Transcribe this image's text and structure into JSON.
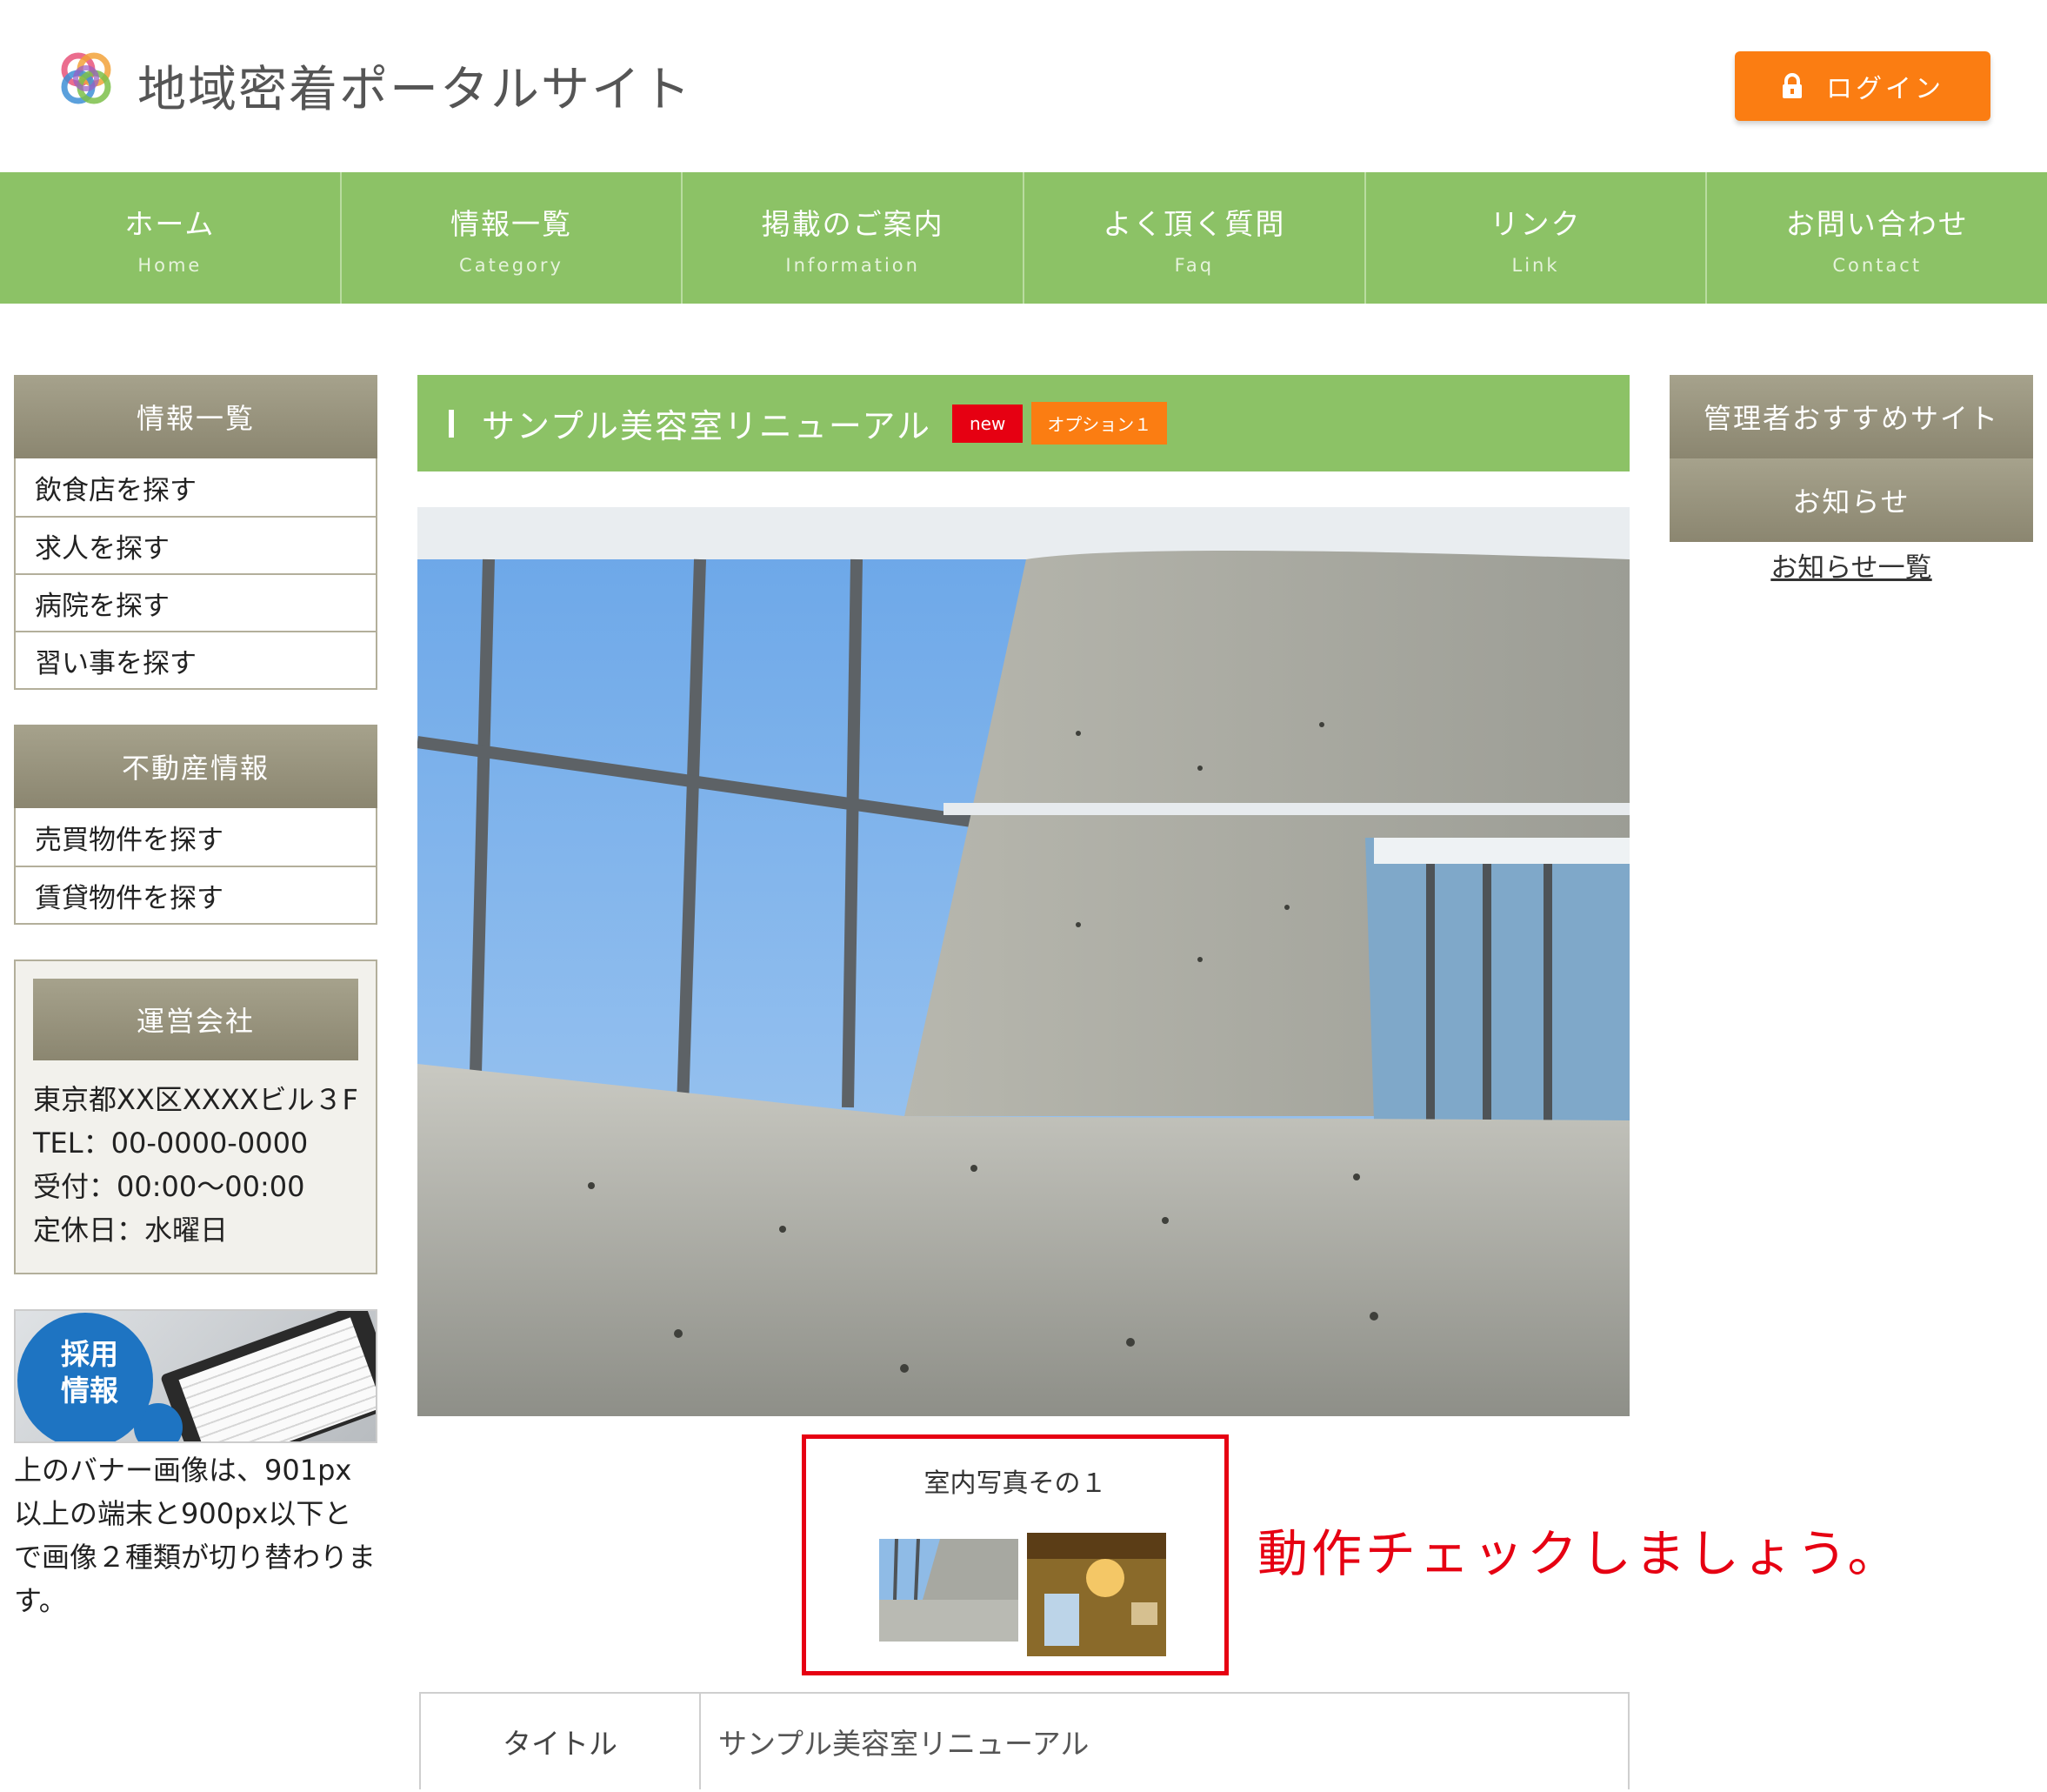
{
  "header": {
    "site_title": "地域密着ポータルサイト",
    "login_label": "ログイン",
    "logo_icon": "interlocking-rings-logo",
    "lock_icon": "lock-icon",
    "login_color": "#fb7d12"
  },
  "nav": {
    "items": [
      {
        "jp": "ホーム",
        "en": "Home"
      },
      {
        "jp": "情報一覧",
        "en": "Category"
      },
      {
        "jp": "掲載のご案内",
        "en": "Information"
      },
      {
        "jp": "よく頂く質問",
        "en": "Faq"
      },
      {
        "jp": "リンク",
        "en": "Link"
      },
      {
        "jp": "お問い合わせ",
        "en": "Contact"
      }
    ],
    "color": "#8cc266"
  },
  "sidebar_left": {
    "info_heading": "情報一覧",
    "info_items": [
      "飲食店を探す",
      "求人を探す",
      "病院を探す",
      "習い事を探す"
    ],
    "realestate_heading": "不動産情報",
    "realestate_items": [
      "売買物件を探す",
      "賃貸物件を探す"
    ],
    "company_heading": "運営会社",
    "company_address": "東京都XX区XXXXビル３F",
    "company_tel": "TEL：00-0000-0000",
    "company_hours": "受付：00:00〜00:00",
    "company_holiday": "定休日：水曜日",
    "banner_text_line1": "採用",
    "banner_text_line2": "情報",
    "banner_note": "上のバナー画像は、901px以上の端末と900px以下とで画像２種類が切り替わります。"
  },
  "main": {
    "title": "サンプル美容室リニューアル",
    "badge_new": "new",
    "badge_option": "オプション１",
    "photo_caption": "室内写真その１",
    "annotation": "動作チェックしましょう。",
    "detail_rows": [
      {
        "label": "タイトル",
        "value": "サンプル美容室リニューアル"
      }
    ]
  },
  "sidebar_right": {
    "recommend_heading": "管理者おすすめサイト",
    "news_heading": "お知らせ",
    "news_link": "お知らせ一覧"
  }
}
